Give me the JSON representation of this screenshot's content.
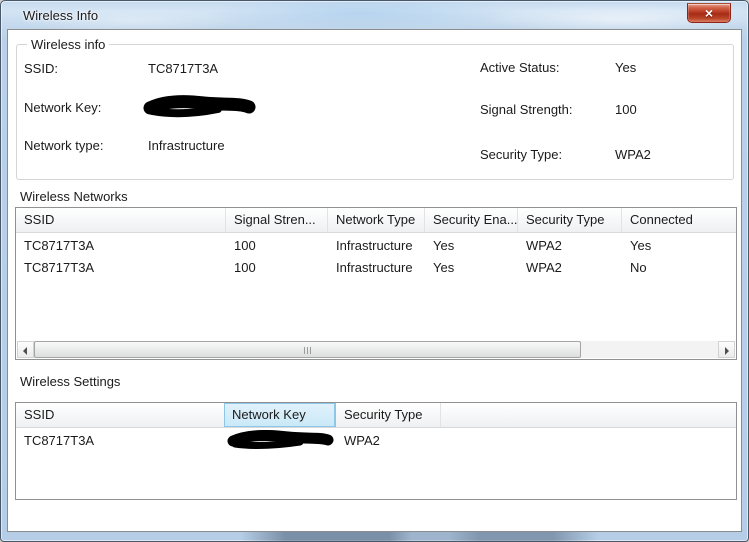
{
  "window": {
    "title": "Wireless Info",
    "close_button": "×"
  },
  "colors": {
    "titlebar_blue": "#c3d9ee",
    "close_button_red": "#b83a22",
    "selected_header_blue": "#cde9f7",
    "table_border_gray": "#919191"
  },
  "info_group": {
    "legend": "Wireless info",
    "ssid_label": "SSID:",
    "ssid_value": "TC8717T3A",
    "network_key_label": "Network Key:",
    "network_key_redacted": true,
    "network_type_label": "Network type:",
    "network_type_value": "Infrastructure",
    "active_status_label": "Active Status:",
    "active_status_value": "Yes",
    "signal_strength_label": "Signal Strength:",
    "signal_strength_value": "100",
    "security_type_label": "Security Type:",
    "security_type_value": "WPA2"
  },
  "networks_table": {
    "title": "Wireless Networks",
    "columns": [
      "SSID",
      "Signal Stren...",
      "Network Type",
      "Security Ena...",
      "Security Type",
      "Connected"
    ],
    "rows": [
      [
        "TC8717T3A",
        "100",
        "Infrastructure",
        "Yes",
        "WPA2",
        "Yes"
      ],
      [
        "TC8717T3A",
        "100",
        "Infrastructure",
        "Yes",
        "WPA2",
        "No"
      ]
    ]
  },
  "settings_table": {
    "title": "Wireless Settings",
    "columns": [
      "SSID",
      "Network Key",
      "Security Type"
    ],
    "selected_column": "Network Key",
    "rows": [
      {
        "ssid": "TC8717T3A",
        "network_key_redacted": true,
        "security_type": "WPA2"
      }
    ]
  }
}
